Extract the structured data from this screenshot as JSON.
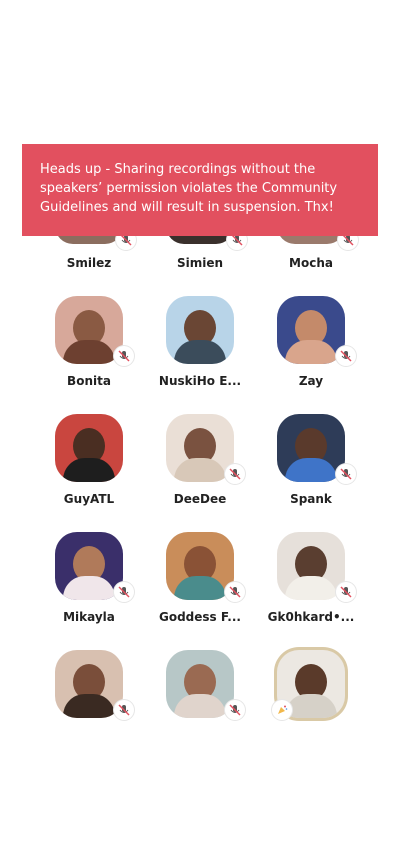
{
  "banner": {
    "text": "Heads up - Sharing recordings without the speakers’ permission violates the Community Guidelines and will result in suspension. Thx!"
  },
  "speakers": [
    {
      "name": "Smilez",
      "muted": true
    },
    {
      "name": "Simien",
      "muted": true
    },
    {
      "name": "Mocha",
      "muted": true
    },
    {
      "name": "Bonita",
      "muted": true
    },
    {
      "name": "NuskiHo E...",
      "muted": false
    },
    {
      "name": "Zay",
      "muted": true
    },
    {
      "name": "GuyATL",
      "muted": false
    },
    {
      "name": "DeeDee",
      "muted": true
    },
    {
      "name": "Spank",
      "muted": true
    },
    {
      "name": "Mikayla",
      "muted": true
    },
    {
      "name": "Goddess F...",
      "muted": true
    },
    {
      "name": "Gk0hkard•...",
      "muted": true
    },
    {
      "name": "",
      "muted": true
    },
    {
      "name": "",
      "muted": true
    },
    {
      "name": "",
      "muted": false,
      "badge": "party-icon"
    }
  ],
  "colors": {
    "banner": "#e2505f",
    "name_text": "#222222"
  }
}
